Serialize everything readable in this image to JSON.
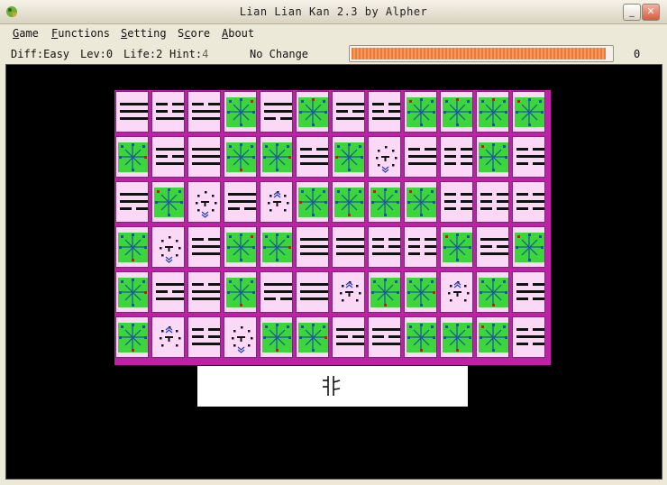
{
  "window": {
    "title": "Lian Lian Kan 2.3 by Alpher",
    "buttons": [
      "minimize",
      "maximize",
      "close"
    ]
  },
  "menu": {
    "items": [
      {
        "label": "Game",
        "underline": "G"
      },
      {
        "label": "Functions",
        "underline": "F"
      },
      {
        "label": "Setting",
        "underline": "S"
      },
      {
        "label": "Score",
        "underline": "c"
      },
      {
        "label": "About",
        "underline": "A"
      }
    ]
  },
  "status": {
    "diff": "Diff:Easy",
    "level": "Lev:0",
    "life": "Life:2",
    "hint_label": "Hint:",
    "hint_value": "4",
    "message": "No Change",
    "score": "0",
    "time_remaining_fraction": 0.985
  },
  "board": {
    "rows": 6,
    "cols": 12,
    "tile_icons": [
      [
        "trigram-6",
        "trigram-5",
        "trigram-3",
        "compass-tr",
        "trigram-2",
        "compass-t",
        "trigram-1",
        "trigram-5",
        "compass-tl",
        "compass-t",
        "compass-t",
        "compass-tl"
      ],
      [
        "compass-r",
        "trigram-1",
        "trigram-6",
        "compass-b",
        "compass-r",
        "trigram-3",
        "compass-l",
        "dots-down",
        "trigram-3",
        "trigram-4",
        "compass-tl",
        "trigram-7"
      ],
      [
        "trigram-2",
        "compass-tl",
        "dots-down",
        "trigram-2",
        "dots-up",
        "compass-l",
        "compass-b",
        "compass-tl",
        "compass-tl",
        "trigram-4",
        "trigram-4",
        "trigram-7"
      ],
      [
        "compass-b",
        "dots-down",
        "trigram-3",
        "compass-tr",
        "compass-r",
        "trigram-6",
        "trigram-6",
        "trigram-5",
        "trigram-4",
        "compass-tl",
        "trigram-1",
        "compass-tl"
      ],
      [
        "compass-r",
        "trigram-1",
        "trigram-3",
        "compass-b",
        "trigram-2",
        "trigram-6",
        "dots-up",
        "compass-b",
        "compass-r",
        "dots-up",
        "compass-b",
        "trigram-7"
      ],
      [
        "compass-b",
        "dots-up",
        "trigram-5",
        "dots-down",
        "compass-b",
        "compass-r",
        "trigram-1",
        "trigram-1",
        "compass-b",
        "compass-b",
        "compass-tl",
        "trigram-7"
      ]
    ]
  },
  "preview": {
    "icon": "mirrored-glyph-icon"
  },
  "colors": {
    "tile_face": "#fbd8f6",
    "tile_edge": "#c020a8",
    "tile_green": "#3cd63c",
    "board_background": "#000000",
    "progress": "#ee7a3a"
  }
}
